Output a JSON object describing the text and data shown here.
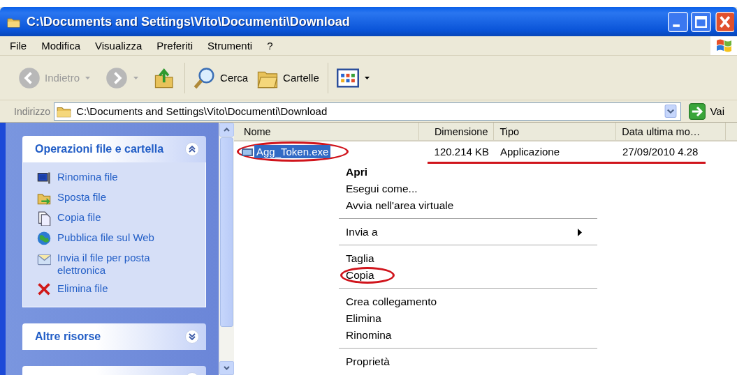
{
  "window": {
    "title": "C:\\Documents and Settings\\Vito\\Documenti\\Download"
  },
  "menu": [
    {
      "label": "File"
    },
    {
      "label": "Modifica"
    },
    {
      "label": "Visualizza"
    },
    {
      "label": "Preferiti"
    },
    {
      "label": "Strumenti"
    },
    {
      "label": "?"
    }
  ],
  "toolbar": [
    {
      "kind": "back",
      "label": "Indietro",
      "disabled": true
    },
    {
      "kind": "forward",
      "disabled": true
    },
    {
      "kind": "up"
    },
    {
      "kind": "search",
      "label": "Cerca"
    },
    {
      "kind": "folders",
      "label": "Cartelle"
    },
    {
      "kind": "views"
    }
  ],
  "address": {
    "label": "Indirizzo",
    "value": "C:\\Documents and Settings\\Vito\\Documenti\\Download",
    "go": "Vai"
  },
  "sidebar": {
    "panels": [
      {
        "title": "Operazioni file e cartella",
        "expanded": true,
        "items": [
          {
            "kind": "rename",
            "label": "Rinomina file"
          },
          {
            "kind": "move",
            "label": "Sposta file"
          },
          {
            "kind": "copy",
            "label": "Copia file"
          },
          {
            "kind": "web",
            "label": "Pubblica file sul Web"
          },
          {
            "kind": "mail",
            "label": "Invia il file per posta elettronica"
          },
          {
            "kind": "delete",
            "label": "Elimina file"
          }
        ]
      },
      {
        "title": "Altre risorse",
        "expanded": false
      },
      {
        "expanded": false
      }
    ]
  },
  "table": {
    "columns": [
      "Nome",
      "Dimensione",
      "Tipo",
      "Data ultima mo…"
    ],
    "rows": [
      {
        "cells": [
          "Agg_Token.exe",
          "120.214 KB",
          "Applicazione",
          "27/09/2010 4.28"
        ],
        "selected": true,
        "circled": true,
        "underlined": true
      }
    ]
  },
  "context_menu": [
    {
      "kind": "item",
      "label": "Apri",
      "default": true
    },
    {
      "kind": "item",
      "label": "Esegui come..."
    },
    {
      "kind": "item",
      "label": "Avvia nell'area virtuale"
    },
    {
      "kind": "separator"
    },
    {
      "kind": "item",
      "label": "Invia a",
      "submenu": true
    },
    {
      "kind": "separator"
    },
    {
      "kind": "item",
      "label": "Taglia"
    },
    {
      "kind": "item",
      "label": "Copia",
      "circled": true
    },
    {
      "kind": "separator"
    },
    {
      "kind": "item",
      "label": "Crea collegamento"
    },
    {
      "kind": "item",
      "label": "Elimina"
    },
    {
      "kind": "item",
      "label": "Rinomina"
    },
    {
      "kind": "separator"
    },
    {
      "kind": "item",
      "label": "Proprietà"
    }
  ]
}
